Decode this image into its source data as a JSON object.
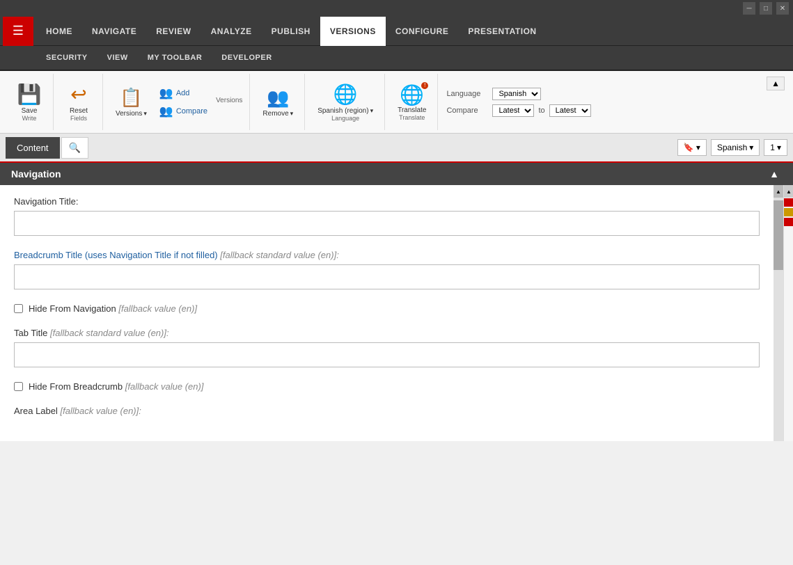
{
  "titlebar": {
    "minimize_label": "─",
    "maximize_label": "□",
    "close_label": "✕"
  },
  "nav": {
    "items": [
      {
        "id": "home",
        "label": "HOME"
      },
      {
        "id": "navigate",
        "label": "NAVIGATE"
      },
      {
        "id": "review",
        "label": "REVIEW"
      },
      {
        "id": "analyze",
        "label": "ANALYZE"
      },
      {
        "id": "publish",
        "label": "PUBLISH"
      },
      {
        "id": "versions",
        "label": "VERSIONS",
        "active": true
      },
      {
        "id": "configure",
        "label": "CONFIGURE"
      },
      {
        "id": "presentation",
        "label": "PRESENTATION"
      }
    ],
    "second_row": [
      {
        "id": "security",
        "label": "SECURITY"
      },
      {
        "id": "view",
        "label": "VIEW"
      },
      {
        "id": "mytoolbar",
        "label": "MY TOOLBAR"
      },
      {
        "id": "developer",
        "label": "DEVELOPER"
      }
    ]
  },
  "toolbar": {
    "save_label": "Save",
    "save_sublabel": "Write",
    "reset_label": "Reset",
    "reset_sublabel": "Fields",
    "versions_label": "Versions",
    "add_label": "Add",
    "compare_label": "Compare",
    "remove_label": "Remove",
    "versions_group_label": "Versions",
    "spanish_region_label": "Spanish (region)",
    "language_group_label": "Language",
    "translate_label": "Translate",
    "translate_group_label": "Translate",
    "language_label": "Language",
    "compare_label2": "Compare",
    "language_value": "Spanish",
    "compare_from": "Latest",
    "compare_to": "Latest",
    "to_label": "to",
    "dropdown_arrow": "▾",
    "collapse_icon": "▲"
  },
  "content": {
    "tab_label": "Content",
    "search_icon": "🔍",
    "language_btn": "Spanish",
    "page_btn": "1",
    "bookmark_icon": "🔖"
  },
  "navigation_section": {
    "title": "Navigation",
    "scroll_up_icon": "▲",
    "collapse_icon": "▲",
    "nav_title_label": "Navigation Title:",
    "breadcrumb_label": "Breadcrumb Title (uses Navigation Title if not filled)",
    "breadcrumb_fallback": "[fallback standard value (en)]:",
    "hide_nav_label": "Hide From Navigation",
    "hide_nav_fallback": "[fallback value (en)]",
    "tab_title_label": "Tab Title",
    "tab_title_fallback": "[fallback standard value (en)]:",
    "hide_breadcrumb_label": "Hide From Breadcrumb",
    "hide_breadcrumb_fallback": "[fallback value (en)]",
    "area_label_label": "Area Label",
    "area_label_fallback": "[fallback value (en)]:"
  },
  "indicators": {
    "red1": "#cc0000",
    "gold": "#cc9900",
    "red2": "#cc0000"
  }
}
